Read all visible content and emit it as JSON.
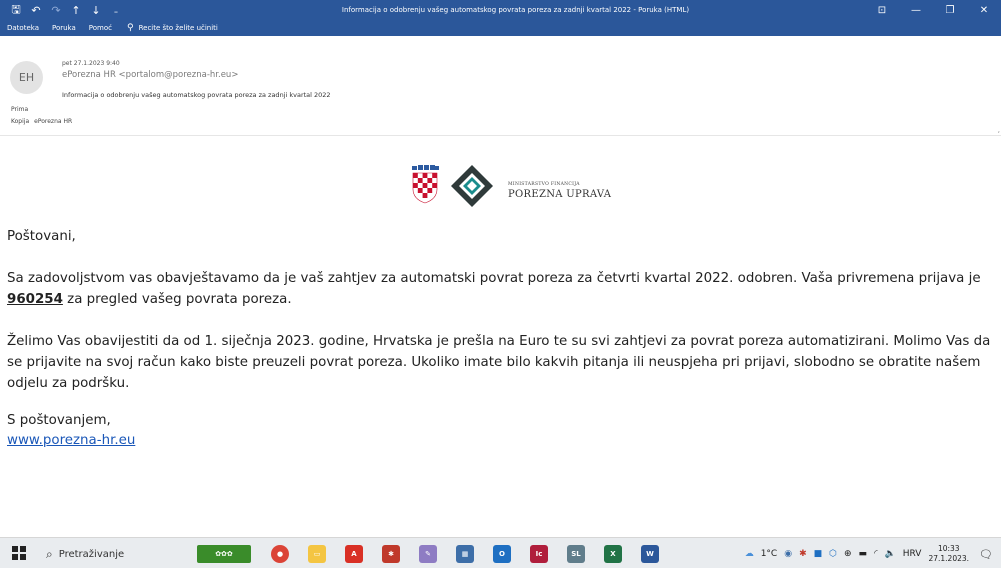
{
  "window": {
    "title": "Informacija o odobrenju vašeg automatskog povrata poreza za zadnji kvartal 2022  -  Poruka (HTML)",
    "quick_access": [
      {
        "icon": "save-icon",
        "glyph": "🖫"
      },
      {
        "icon": "undo-icon",
        "glyph": "↶"
      },
      {
        "icon": "redo-icon",
        "glyph": "↷"
      },
      {
        "icon": "up-arrow-icon",
        "glyph": "↑"
      },
      {
        "icon": "down-arrow-icon",
        "glyph": "↓"
      },
      {
        "icon": "customize-icon",
        "glyph": "⇩"
      }
    ],
    "controls": {
      "ribbon_display": "⊡",
      "minimize": "—",
      "maximize": "❐",
      "close": "✕"
    }
  },
  "ribbon": {
    "tabs": [
      "Datoteka",
      "Poruka",
      "Pomoć"
    ],
    "tell_me": "Recite što želite učiniti"
  },
  "header": {
    "avatar_initials": "EH",
    "date": "pet 27.1.2023 9:40",
    "from": "ePorezna HR <portalom@porezna-hr.eu>",
    "subject": "Informacija o odobrenju vašeg automatskog povrata poreza za zadnji kvartal 2022",
    "to_label": "Prima",
    "cc_label": "Kopija",
    "cc_value": "ePorezna HR"
  },
  "logo": {
    "ministry": "MINISTARSTVO FINANCIJA",
    "name": "POREZNA UPRAVA"
  },
  "body": {
    "greeting": "Poštovani,",
    "p1_before": "Sa zadovoljstvom vas obavještavamo da je vaš zahtjev za automatski povrat poreza za četvrti kvartal 2022. odobren. Vaša privremena prijava je ",
    "p1_code": "960254",
    "p1_after": " za pregled vašeg povrata poreza.",
    "p2": "Želimo Vas obavijestiti da od 1. siječnja 2023. godine, Hrvatska je prešla na Euro te su svi zahtjevi za povrat poreza automatizirani. Molimo Vas da se prijavite na svoj račun kako biste preuzeli povrat poreza. Ukoliko imate bilo kakvih pitanja ili neuspjeha pri prijavi, slobodno se obratite našem odjelu za podršku.",
    "closing": "S poštovanjem,",
    "link": "www.porezna-hr.eu"
  },
  "taskbar": {
    "search_placeholder": "Pretraživanje",
    "apps": [
      {
        "name": "chrome-icon",
        "color": "#db4437"
      },
      {
        "name": "file-explorer-icon",
        "color": "#f4c542"
      },
      {
        "name": "pdf-app-icon",
        "color": "#d93025"
      },
      {
        "name": "ant-app-icon",
        "color": "#c0392b"
      },
      {
        "name": "paint-app-icon",
        "color": "#8e7cc3"
      },
      {
        "name": "calculator-icon",
        "color": "#3d6ea8"
      },
      {
        "name": "outlook-icon",
        "color": "#1e6fc2"
      },
      {
        "name": "ic-app-icon",
        "color": "#b01e3c"
      },
      {
        "name": "sql-app-icon",
        "color": "#607d8b"
      },
      {
        "name": "excel-icon",
        "color": "#217346"
      },
      {
        "name": "word-icon",
        "color": "#2b579a"
      }
    ],
    "weather": "1°C",
    "language": "HRV",
    "time": "10:33",
    "date": "27.1.2023."
  }
}
